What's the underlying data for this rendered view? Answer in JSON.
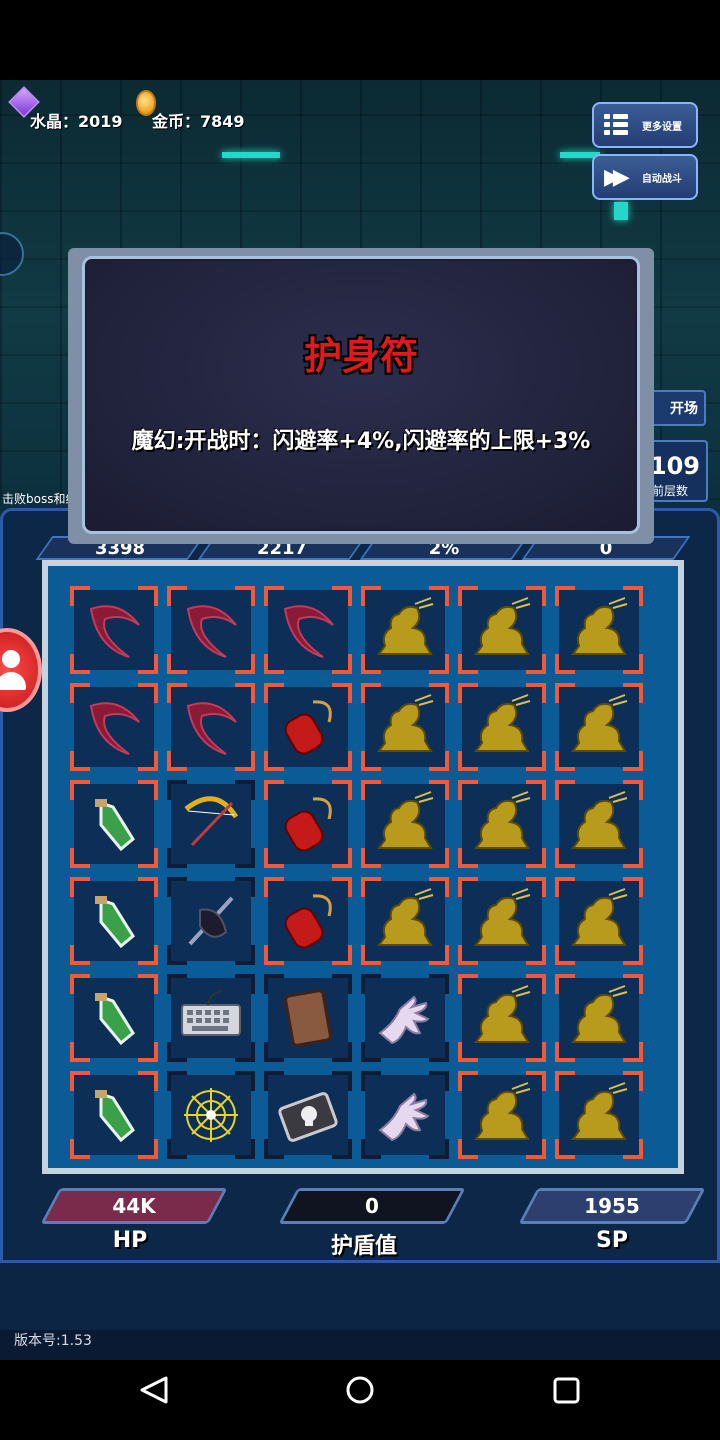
{
  "resources": {
    "crystal_label": "水晶：2019",
    "gold_label": "金币：7849"
  },
  "top_buttons": {
    "settings_label": "更多设置",
    "auto_battle_label": "自动战斗"
  },
  "side": {
    "right_button_label": "开场",
    "floor_number": "109",
    "floor_label": "前层数",
    "left_note": "击败boss和约"
  },
  "popup": {
    "title": "护身符",
    "description": "魔幻:开战时：闪避率+4%,闪避率的上限+3%"
  },
  "stats": [
    "3398",
    "2217",
    "2%",
    "0"
  ],
  "board": {
    "rows": [
      [
        "scythe",
        "scythe",
        "scythe",
        "golden-dragon",
        "golden-dragon",
        "golden-dragon"
      ],
      [
        "scythe",
        "scythe",
        "red-amulet",
        "golden-dragon",
        "golden-dragon",
        "golden-dragon"
      ],
      [
        "green-potion",
        "golden-bow",
        "red-amulet",
        "golden-dragon",
        "golden-dragon",
        "golden-dragon"
      ],
      [
        "green-potion",
        "dark-sword",
        "red-amulet",
        "golden-dragon",
        "golden-dragon",
        "golden-dragon"
      ],
      [
        "green-potion",
        "keyboard",
        "leather-book",
        "white-glove",
        "golden-dragon",
        "golden-dragon"
      ],
      [
        "green-potion",
        "golden-web",
        "skull-book",
        "white-glove",
        "golden-dragon",
        "golden-dragon"
      ]
    ],
    "frame_colors": {
      "active": "#f05a3a",
      "inactive": "#0f1c36"
    }
  },
  "bars": {
    "hp_value": "44K",
    "hp_label": "HP",
    "shield_value": "0",
    "shield_label": "护盾值",
    "sp_value": "1955",
    "sp_label": "SP"
  },
  "version": "版本号:1.53",
  "colors": {
    "title_red": "#e01a1a",
    "hp_bar": "#7a2a4a",
    "shield_bar": "#101421",
    "sp_bar": "#2c3f6e"
  }
}
